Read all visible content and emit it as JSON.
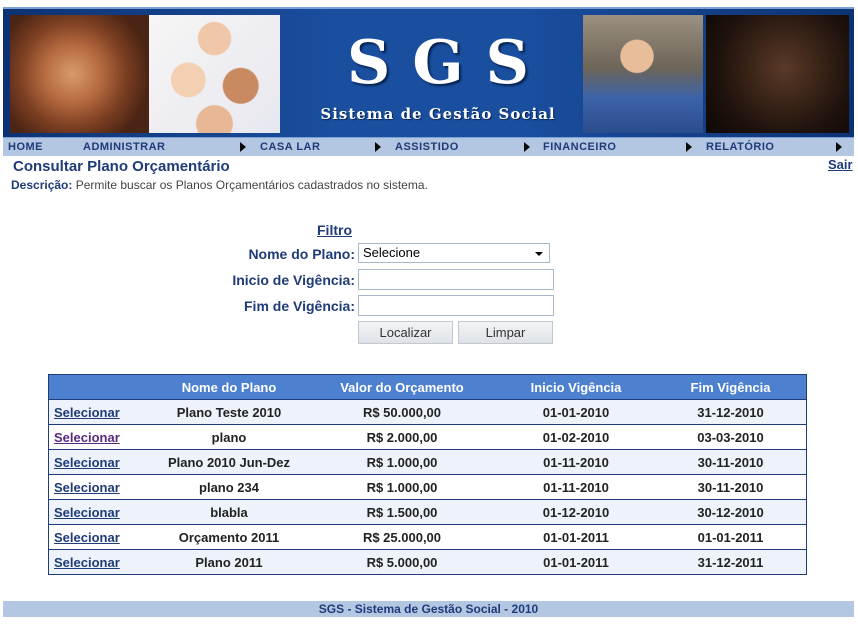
{
  "header": {
    "logo_title": "SGS",
    "logo_subtitle": "Sistema de Gestão Social"
  },
  "menu": {
    "items": [
      {
        "label": "HOME"
      },
      {
        "label": "ADMINISTRAR"
      },
      {
        "label": "CASA LAR"
      },
      {
        "label": "ASSISTIDO"
      },
      {
        "label": "FINANCEIRO"
      },
      {
        "label": "RELATÓRIO"
      }
    ]
  },
  "page": {
    "title": "Consultar Plano Orçamentário",
    "logout": "Sair",
    "desc_label": "Descrição:",
    "desc_text": " Permite buscar os Planos Orçamentários cadastrados no sistema."
  },
  "filter": {
    "title": "Filtro",
    "plan_name_label": "Nome do Plano:",
    "plan_name_value": "Selecione",
    "start_label": "Inicio de Vigência:",
    "start_value": "",
    "end_label": "Fim de Vigência:",
    "end_value": "",
    "search_button": "Localizar",
    "clear_button": "Limpar"
  },
  "table": {
    "headers": [
      "",
      "Nome do Plano",
      "Valor do Orçamento",
      "Inicio Vigência",
      "Fim Vigência"
    ],
    "select_label": "Selecionar",
    "rows": [
      {
        "name": "Plano Teste 2010",
        "value": "R$ 50.000,00",
        "start": "01-01-2010",
        "end": "31-12-2010"
      },
      {
        "name": "plano",
        "value": "R$ 2.000,00",
        "start": "01-02-2010",
        "end": "03-03-2010"
      },
      {
        "name": "Plano 2010 Jun-Dez",
        "value": "R$ 1.000,00",
        "start": "01-11-2010",
        "end": "30-11-2010"
      },
      {
        "name": "plano 234",
        "value": "R$ 1.000,00",
        "start": "01-11-2010",
        "end": "30-11-2010"
      },
      {
        "name": "blabla",
        "value": "R$ 1.500,00",
        "start": "01-12-2010",
        "end": "30-12-2010"
      },
      {
        "name": "Orçamento 2011",
        "value": "R$ 25.000,00",
        "start": "01-01-2011",
        "end": "01-01-2011"
      },
      {
        "name": "Plano 2011",
        "value": "R$ 5.000,00",
        "start": "01-01-2011",
        "end": "31-12-2011"
      }
    ]
  },
  "footer": {
    "text": "SGS - Sistema de Gestão Social - 2010"
  },
  "colors": {
    "accent": "#1f3b78",
    "header_blue": "#113e84",
    "menu_bg": "#b3c6e2",
    "table_header": "#4e80d0"
  }
}
